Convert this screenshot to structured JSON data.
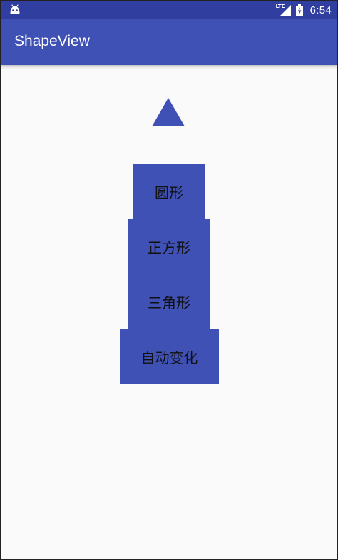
{
  "status_bar": {
    "network_label": "LTE",
    "time": "6:54",
    "color": "#303f9f",
    "icons": [
      "android-icon",
      "lte-signal-icon",
      "battery-charging-icon"
    ]
  },
  "app_bar": {
    "title": "ShapeView",
    "color": "#3f51b5"
  },
  "shape_view": {
    "current_shape": "triangle",
    "color": "#3f51b5"
  },
  "buttons": [
    {
      "label": "圆形"
    },
    {
      "label": "正方形"
    },
    {
      "label": "三角形"
    },
    {
      "label": "自动变化"
    }
  ],
  "colors": {
    "background": "#fafafa",
    "button": "#3f51b5",
    "button_text": "#111111"
  }
}
